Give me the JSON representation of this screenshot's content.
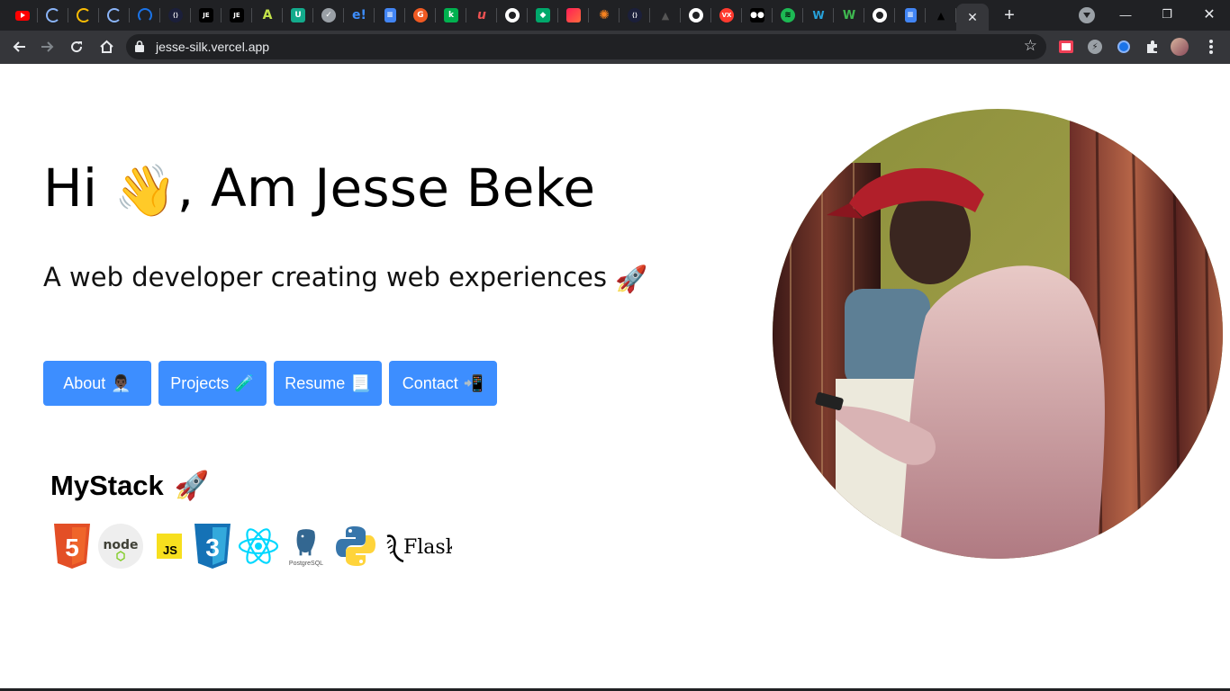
{
  "browser": {
    "tab_favicons": [
      "youtube-icon",
      "loading-icon",
      "loading-icon",
      "loading-icon",
      "sync-icon",
      "dev-icon",
      "je-icon",
      "je-icon",
      "app-icon",
      "green-app-icon",
      "check-icon",
      "ebay-icon",
      "docs-icon",
      "orange-icon",
      "green-k-icon",
      "u-icon",
      "github-icon",
      "shield-icon",
      "red-icon",
      "orange-star-icon",
      "dev-icon",
      "triangle-icon",
      "github-icon",
      "vx-icon",
      "medium-icon",
      "spotify-icon",
      "blue-icon",
      "w-icon",
      "github-icon",
      "docs-icon",
      "triangle-icon"
    ],
    "url": "jesse-silk.vercel.app"
  },
  "hero": {
    "greeting_prefix": "Hi",
    "greeting_emoji": "👋",
    "greeting_suffix": ", Am Jesse Beke",
    "subtitle": "A web developer creating web experiences",
    "subtitle_emoji": "🚀"
  },
  "nav": {
    "about_label": "About",
    "about_emoji": "👨🏿‍💼",
    "projects_label": "Projects",
    "projects_emoji": "🧪",
    "resume_label": "Resume",
    "resume_emoji": "📃",
    "contact_label": "Contact",
    "contact_emoji": "📲"
  },
  "stack": {
    "title": "MyStack",
    "title_emoji": "🚀",
    "html5_text": "5",
    "node_text": "node",
    "js_text": "JS",
    "css3_text": "3",
    "postgres_text": "PostgreSQL",
    "flask_text": "Flask",
    "items": [
      "html5-logo",
      "nodejs-logo",
      "javascript-logo",
      "css3-logo",
      "react-logo",
      "postgresql-logo",
      "python-logo",
      "flask-logo"
    ]
  },
  "colors": {
    "button_bg": "#3d8eff",
    "chrome_dark": "#202124",
    "chrome_toolbar": "#35363a"
  }
}
